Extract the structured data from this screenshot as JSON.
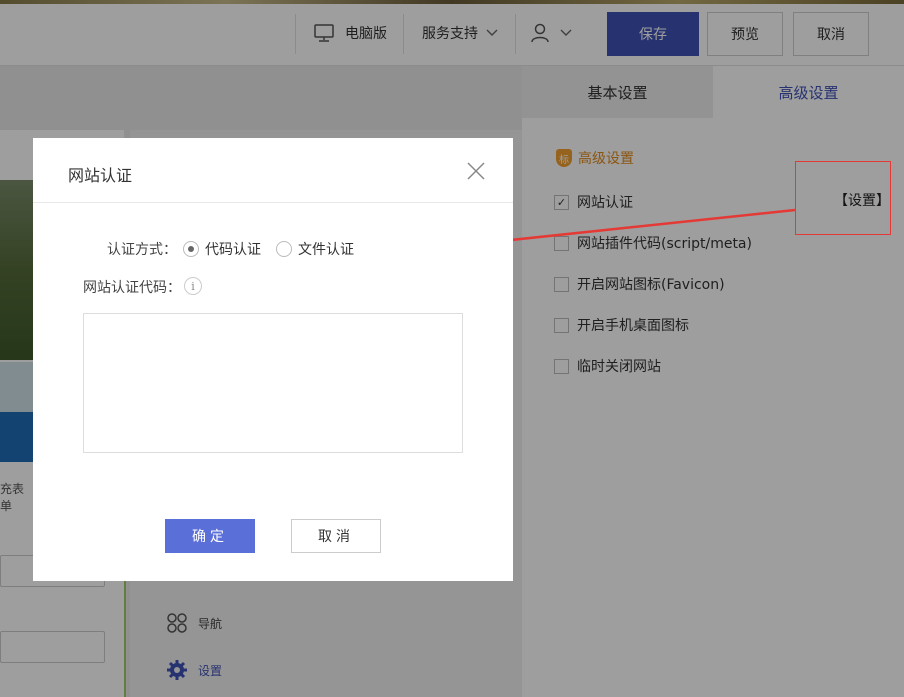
{
  "topbar": {
    "device_label": "电脑版",
    "support_label": "服务支持",
    "save_label": "保存",
    "preview_label": "预览",
    "cancel_label": "取消"
  },
  "canvas": {
    "partial_text": "充表单"
  },
  "tools": [
    {
      "label": "导航",
      "icon": "grid-icon"
    },
    {
      "label": "设置",
      "icon": "gear-icon"
    }
  ],
  "right_panel": {
    "tabs": [
      {
        "label": "基本设置",
        "active": false
      },
      {
        "label": "高级设置",
        "active": true
      }
    ],
    "section_badge": "标",
    "section_title": "高级设置",
    "options": [
      {
        "label": "网站认证",
        "checked": true
      },
      {
        "label": "网站插件代码(script/meta)",
        "checked": false
      },
      {
        "label": "开启网站图标(Favicon)",
        "checked": false
      },
      {
        "label": "开启手机桌面图标",
        "checked": false
      },
      {
        "label": "临时关闭网站",
        "checked": false
      }
    ],
    "set_link": "【设置】"
  },
  "dialog": {
    "title": "网站认证",
    "method_label": "认证方式：",
    "method_options": [
      {
        "label": "代码认证",
        "selected": true
      },
      {
        "label": "文件认证",
        "selected": false
      }
    ],
    "code_label": "网站认证代码：",
    "info_glyph": "i",
    "code_value": "",
    "ok_label": "确定",
    "cancel_label": "取消"
  },
  "colors": {
    "primary": "#3f51b5",
    "dialog_ok": "#5b6fd9",
    "accent_orange": "#e08a1e",
    "annotation_red": "#e53935"
  }
}
